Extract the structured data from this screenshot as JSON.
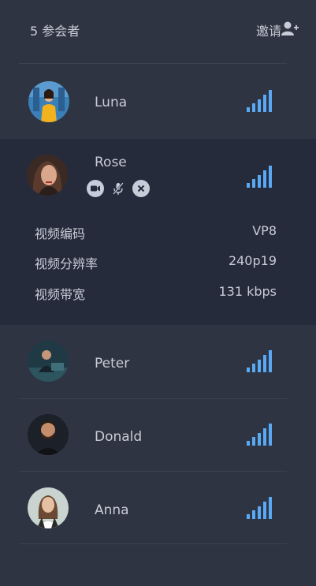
{
  "header": {
    "participant_count": "5 参会者",
    "invite_label": "邀请"
  },
  "icons": {
    "invite": "add-user-icon",
    "signal": "signal-bars-icon",
    "camera": "camera-icon",
    "mic_muted": "mic-muted-icon",
    "remove": "close-icon"
  },
  "participants": [
    {
      "name": "Luna",
      "signal_level": 4
    },
    {
      "name": "Rose",
      "signal_level": 4,
      "expanded": true,
      "stats": [
        {
          "label": "视频编码",
          "value": "VP8"
        },
        {
          "label": "视频分辨率",
          "value": "240p19"
        },
        {
          "label": "视频带宽",
          "value": "131 kbps"
        }
      ]
    },
    {
      "name": "Peter",
      "signal_level": 4
    },
    {
      "name": "Donald",
      "signal_level": 4
    },
    {
      "name": "Anna",
      "signal_level": 4
    }
  ],
  "colors": {
    "panel_bg": "#2e3442",
    "expanded_bg": "#252b3b",
    "signal": "#5aa9f5",
    "text": "#c8ccd6"
  }
}
